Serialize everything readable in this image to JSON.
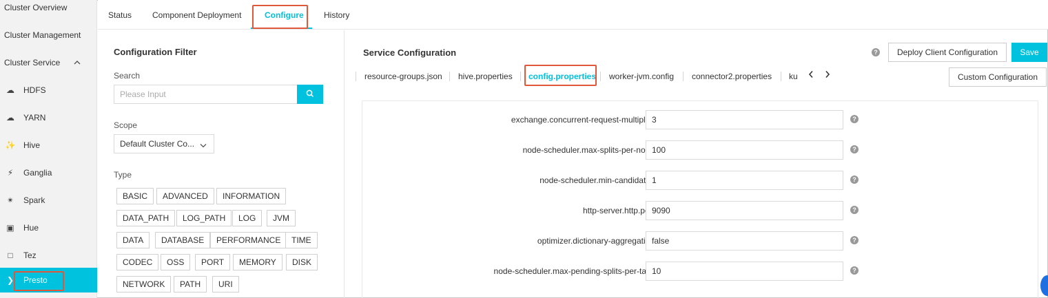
{
  "sidebar": {
    "top_items": [
      {
        "label": "Cluster Overview"
      },
      {
        "label": "Cluster Management"
      },
      {
        "label": "Cluster Service"
      }
    ],
    "services": [
      {
        "label": "HDFS",
        "icon": "hdfs-icon",
        "glyph": "☁"
      },
      {
        "label": "YARN",
        "icon": "yarn-icon",
        "glyph": "☁"
      },
      {
        "label": "Hive",
        "icon": "hive-icon",
        "glyph": "✨"
      },
      {
        "label": "Ganglia",
        "icon": "ganglia-icon",
        "glyph": "⚡"
      },
      {
        "label": "Spark",
        "icon": "spark-icon",
        "glyph": "✴"
      },
      {
        "label": "Hue",
        "icon": "hue-icon",
        "glyph": "▣"
      },
      {
        "label": "Tez",
        "icon": "tez-icon",
        "glyph": "□"
      },
      {
        "label": "Presto",
        "icon": "presto-icon",
        "glyph": "❯"
      }
    ],
    "active_service": "Presto"
  },
  "tabs": {
    "items": [
      {
        "label": "Status"
      },
      {
        "label": "Component Deployment"
      },
      {
        "label": "Configure"
      },
      {
        "label": "History"
      }
    ],
    "active": "Configure"
  },
  "filter": {
    "title": "Configuration Filter",
    "search_label": "Search",
    "search_placeholder": "Please Input",
    "scope_label": "Scope",
    "scope_value": "Default Cluster Co...",
    "type_label": "Type",
    "types": [
      [
        "BASIC",
        "ADVANCED",
        "INFORMATION"
      ],
      [
        "DATA_PATH",
        "LOG_PATH",
        "LOG",
        "JVM"
      ],
      [
        "DATA",
        "DATABASE",
        "PERFORMANCE",
        "TIME"
      ],
      [
        "CODEC",
        "OSS",
        "PORT",
        "MEMORY",
        "DISK"
      ],
      [
        "NETWORK",
        "PATH",
        "URI"
      ]
    ]
  },
  "service_config": {
    "title": "Service Configuration",
    "deploy_button": "Deploy Client Configuration",
    "save_button": "Save",
    "custom_button": "Custom Configuration",
    "file_tabs": [
      "resource-groups.json",
      "hive.properties",
      "config.properties",
      "worker-jvm.config",
      "connector2.properties",
      "ku"
    ],
    "active_file": "config.properties",
    "rows": [
      {
        "key": "exchange.concurrent-request-multiplier",
        "value": "3"
      },
      {
        "key": "node-scheduler.max-splits-per-node",
        "value": "100"
      },
      {
        "key": "node-scheduler.min-candidates",
        "value": "1"
      },
      {
        "key": "http-server.http.port",
        "value": "9090"
      },
      {
        "key": "optimizer.dictionary-aggregation",
        "value": "false"
      },
      {
        "key": "node-scheduler.max-pending-splits-per-task",
        "value": "10"
      }
    ]
  },
  "colors": {
    "accent": "#00c1de",
    "highlight_box": "#e0573a"
  }
}
